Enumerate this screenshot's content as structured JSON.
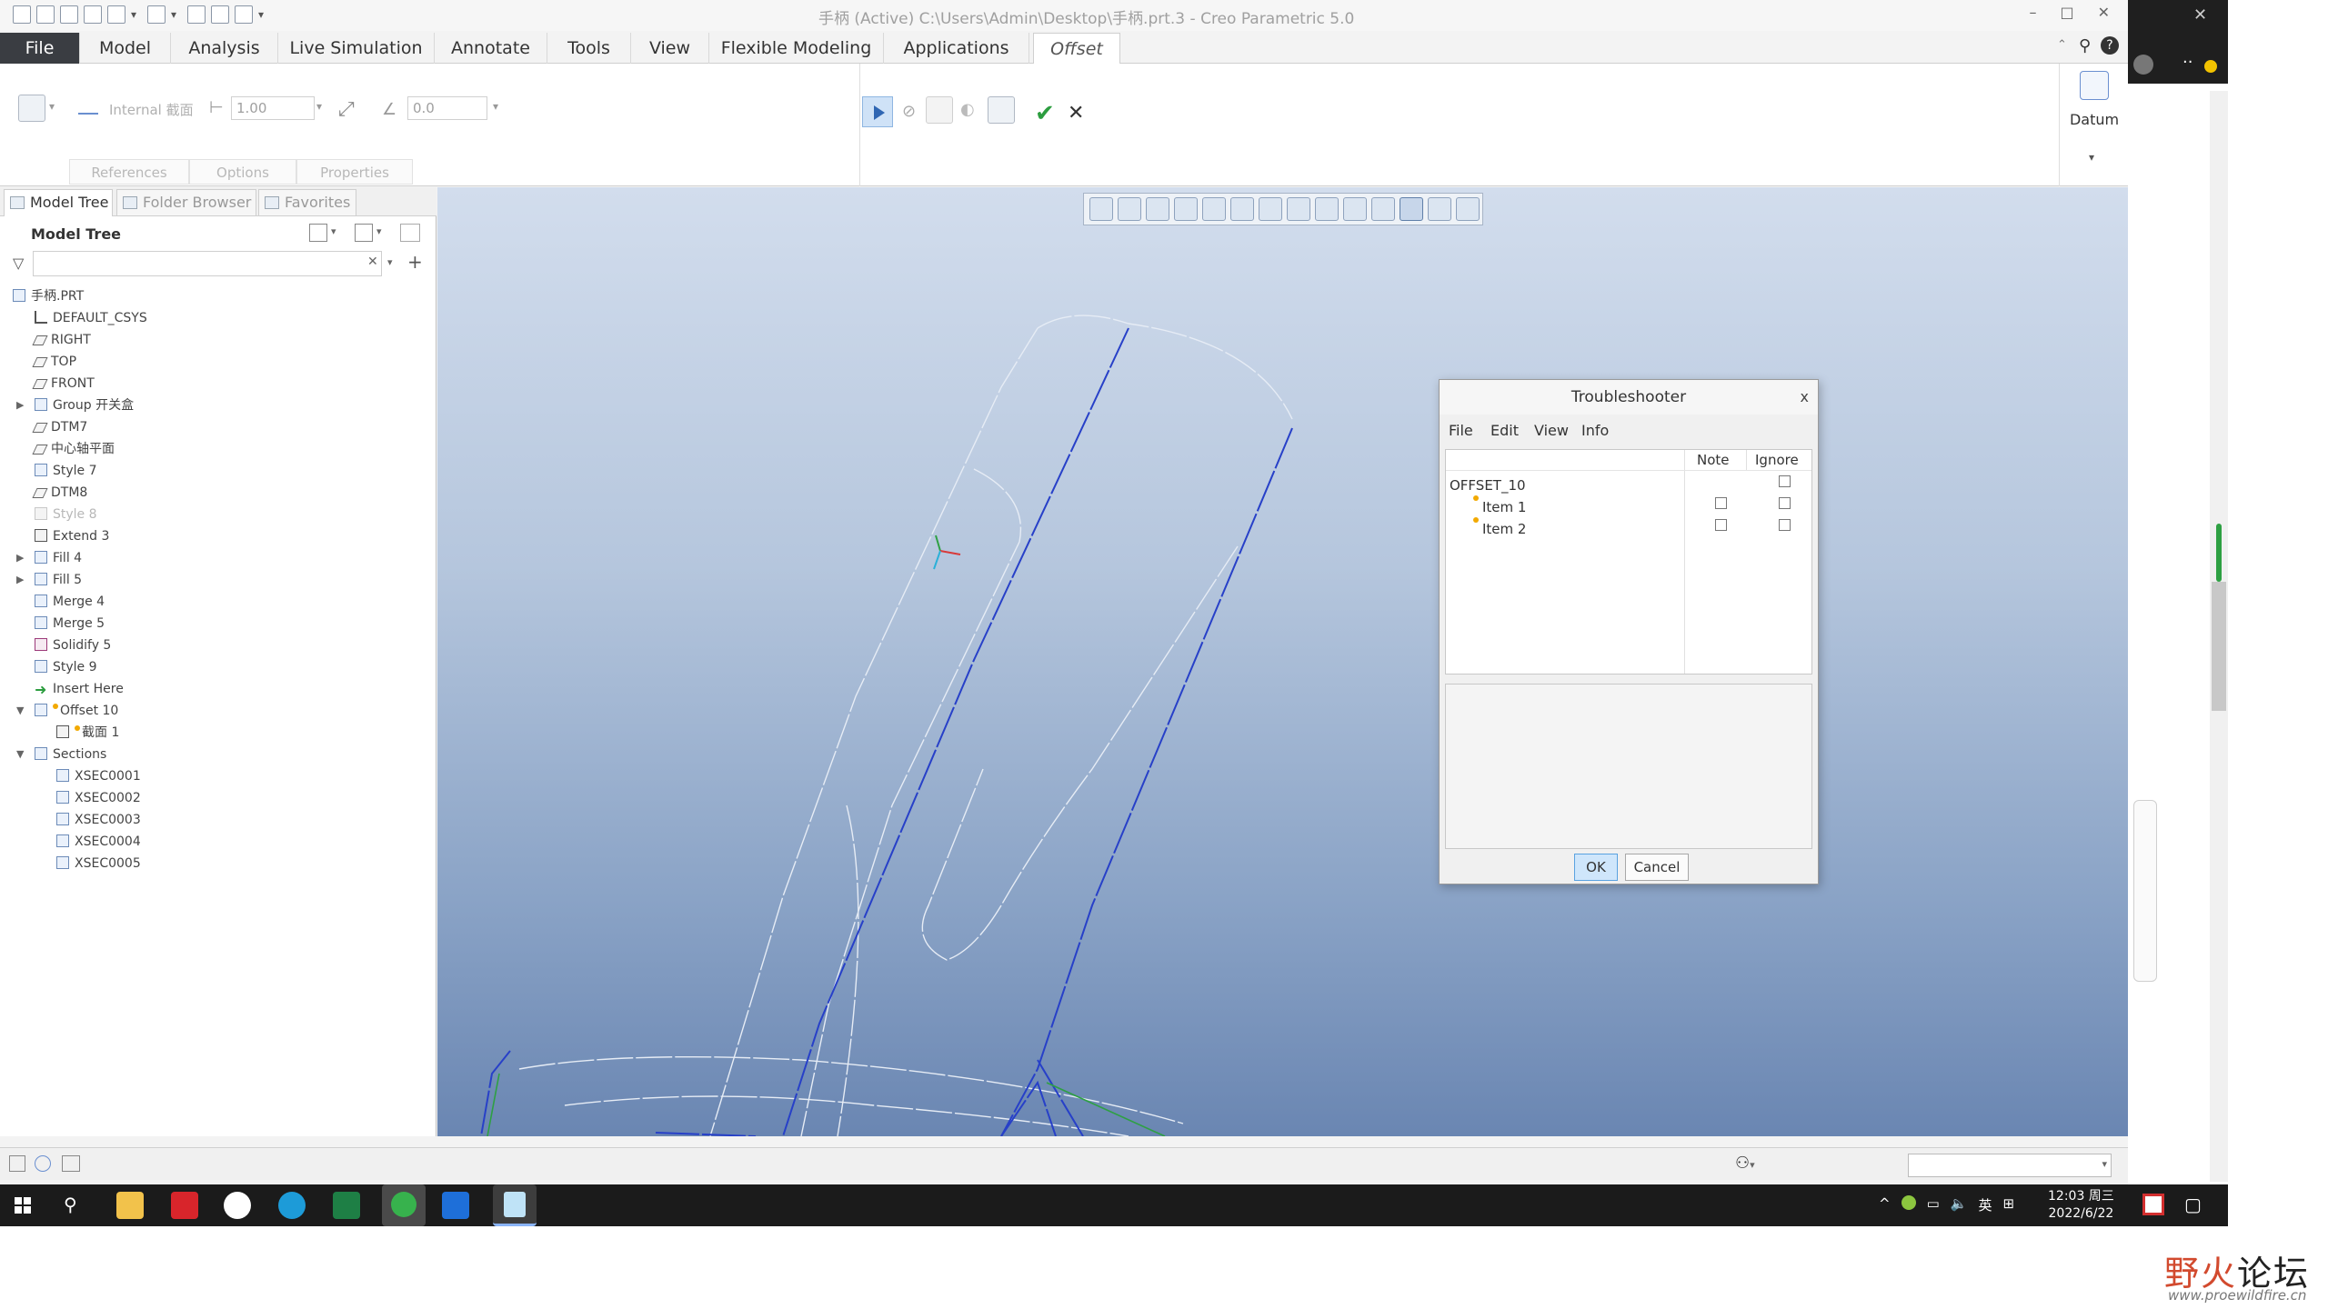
{
  "window": {
    "title": "手柄 (Active) C:\\Users\\Admin\\Desktop\\手柄.prt.3 - Creo Parametric 5.0",
    "controls": [
      "–",
      "□",
      "✕"
    ]
  },
  "ribbon_tabs": [
    {
      "label": "File"
    },
    {
      "label": "Model"
    },
    {
      "label": "Analysis"
    },
    {
      "label": "Live Simulation"
    },
    {
      "label": "Annotate"
    },
    {
      "label": "Tools"
    },
    {
      "label": "View"
    },
    {
      "label": "Flexible Modeling"
    },
    {
      "label": "Applications"
    },
    {
      "label": "Offset"
    }
  ],
  "ribbon": {
    "section_type": "Internal 截面",
    "offset_value": "1.00",
    "angle_value": "0.0",
    "subtabs": [
      "References",
      "Options",
      "Properties"
    ],
    "datum_label": "Datum"
  },
  "left_panel": {
    "tabs": [
      "Model Tree",
      "Folder Browser",
      "Favorites"
    ],
    "title": "Model Tree",
    "tree": [
      {
        "label": "手柄.PRT"
      },
      {
        "label": "DEFAULT_CSYS"
      },
      {
        "label": "RIGHT"
      },
      {
        "label": "TOP"
      },
      {
        "label": "FRONT"
      },
      {
        "label": "Group 开关盒"
      },
      {
        "label": "DTM7"
      },
      {
        "label": "中心轴平面"
      },
      {
        "label": "Style 7"
      },
      {
        "label": "DTM8"
      },
      {
        "label": "Style 8"
      },
      {
        "label": "Extend 3"
      },
      {
        "label": "Fill 4"
      },
      {
        "label": "Fill 5"
      },
      {
        "label": "Merge 4"
      },
      {
        "label": "Merge 5"
      },
      {
        "label": "Solidify 5"
      },
      {
        "label": "Style 9"
      },
      {
        "label": "Insert Here"
      },
      {
        "label": "Offset 10"
      },
      {
        "label": "截面 1"
      },
      {
        "label": "Sections"
      },
      {
        "label": "XSEC0001"
      },
      {
        "label": "XSEC0002"
      },
      {
        "label": "XSEC0003"
      },
      {
        "label": "XSEC0004"
      },
      {
        "label": "XSEC0005"
      }
    ]
  },
  "dialog": {
    "title": "Troubleshooter",
    "close": "x",
    "menu": [
      "File",
      "Edit",
      "View",
      "Info"
    ],
    "col_note": "Note",
    "col_ignore": "Ignore",
    "rows": [
      {
        "label": "OFFSET_10"
      },
      {
        "label": "Item 1"
      },
      {
        "label": "Item 2"
      }
    ],
    "ok": "OK",
    "cancel": "Cancel"
  },
  "taskbar": {
    "tray": [
      "^",
      "英",
      "⊞"
    ],
    "time": "12:03 周三",
    "date": "2022/6/22"
  },
  "watermark": {
    "cn_a": "野火",
    "cn_b": "论坛",
    "url": "www.proewildfire.cn"
  }
}
